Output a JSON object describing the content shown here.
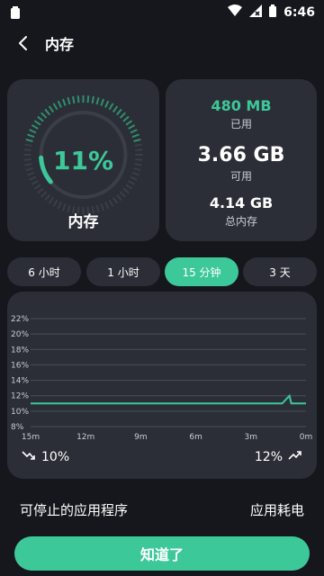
{
  "status": {
    "time": "6:46",
    "icons": [
      "battery-small-icon",
      "wifi-icon",
      "signal-off-icon",
      "battery-icon"
    ]
  },
  "header": {
    "title": "内存",
    "back_icon": "chevron-left-icon"
  },
  "memory": {
    "percent": "11%",
    "percent_value": 0.11,
    "label": "内存",
    "used_value": "480 MB",
    "used_label": "已用",
    "available_value": "3.66 GB",
    "available_label": "可用",
    "total_value": "4.14 GB",
    "total_label": "总内存"
  },
  "tabs": [
    {
      "label": "6 小时"
    },
    {
      "label": "1 小时"
    },
    {
      "label": "15 分钟"
    },
    {
      "label": "3 天"
    }
  ],
  "chart_footer": {
    "min": "10%",
    "max": "12%"
  },
  "chart_data": {
    "type": "line",
    "title": "",
    "xlabel": "",
    "ylabel": "",
    "x_ticks": [
      "15m",
      "12m",
      "9m",
      "6m",
      "3m",
      "0m"
    ],
    "y_ticks": [
      "22%",
      "20%",
      "18%",
      "16%",
      "14%",
      "12%",
      "10%",
      "8%"
    ],
    "ylim": [
      8,
      22
    ],
    "x_minutes_ago": [
      15,
      1.3,
      0.9,
      0.8,
      0
    ],
    "series": [
      {
        "values": [
          11,
          11,
          12,
          11,
          11
        ]
      }
    ],
    "grid": true,
    "color": "#3dc89a"
  },
  "bottom": {
    "left_label": "可停止的应用程序",
    "right_label": "应用耗电"
  },
  "button": {
    "label": "知道了"
  },
  "colors": {
    "accent": "#3dc89a",
    "card": "#2b2e36",
    "background": "#15171c"
  }
}
